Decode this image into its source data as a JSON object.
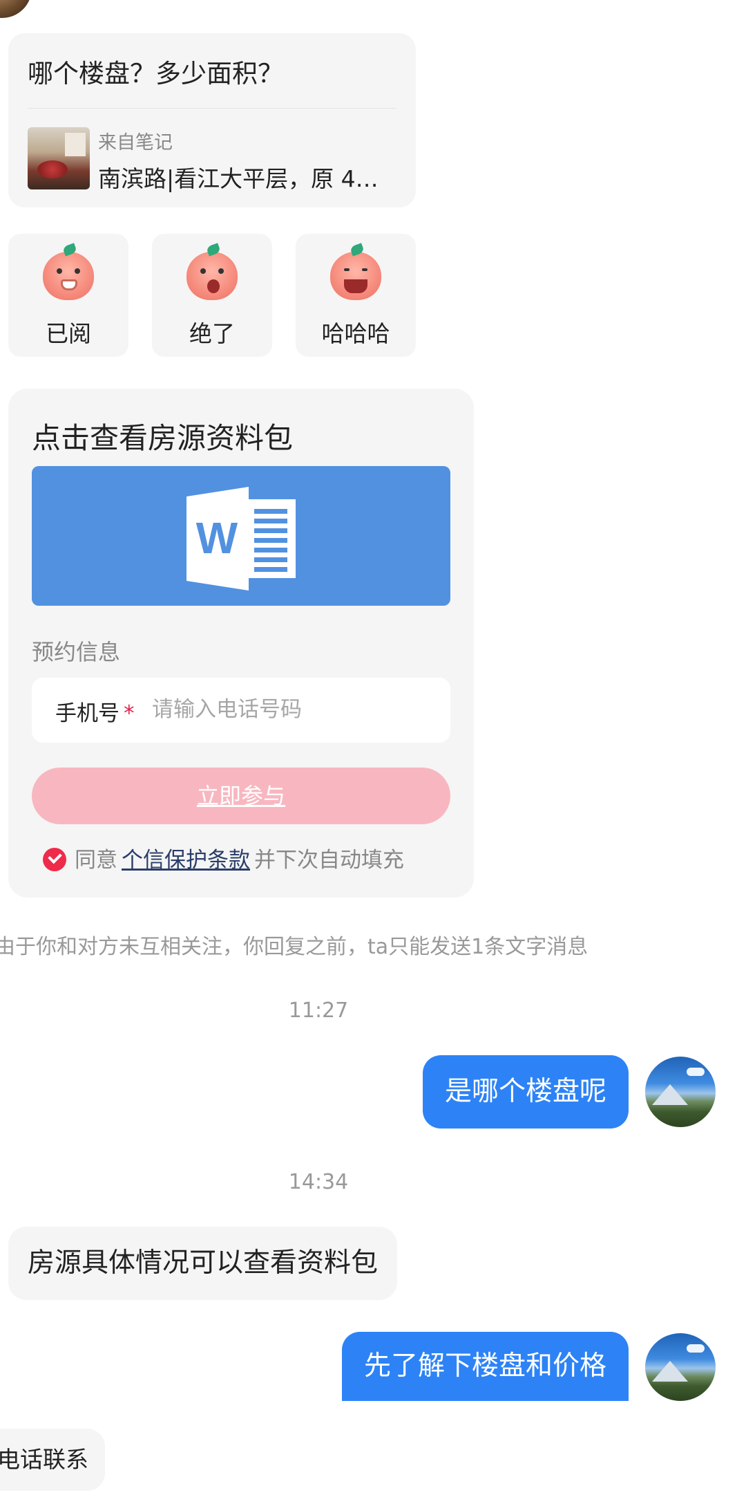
{
  "quote_card": {
    "cut_text": "……………………",
    "question": "哪个楼盘？多少面积？",
    "source_label": "来自笔记",
    "note_title": "南滨路|看江大平层，原 4…"
  },
  "stickers": [
    {
      "label": "已阅",
      "icon": "drinking-peach-sticker-icon"
    },
    {
      "label": "绝了",
      "icon": "thumbs-up-peach-sticker-icon"
    },
    {
      "label": "哈哈哈",
      "icon": "laughing-peach-sticker-icon"
    }
  ],
  "doc_card": {
    "title": "点击查看房源资料包",
    "banner_icon": "word-document-icon",
    "banner_color": "#5291e0",
    "appointment_label": "预约信息",
    "phone_label": "手机号",
    "required_mark": "*",
    "phone_placeholder": "请输入电话号码",
    "phone_value": "",
    "join_button": "立即参与",
    "agree_prefix": "同意",
    "agree_link": "个信保护条款",
    "agree_suffix": "并下次自动填充"
  },
  "system_tip": "由于你和对方未互相关注，你回复之前，ta只能发送1条文字消息",
  "messages": [
    {
      "time": "11:27"
    },
    {
      "direction": "out",
      "text": "是哪个楼盘呢"
    },
    {
      "time": "14:34"
    },
    {
      "direction": "in",
      "text": "房源具体情况可以查看资料包"
    },
    {
      "direction": "out",
      "text": "先了解下楼盘和价格"
    },
    {
      "direction": "in",
      "text": "电话联系"
    }
  ],
  "colors": {
    "accent_blue": "#2d83f6",
    "button_pink": "#f8b7c0",
    "check_red": "#ef2b4a"
  }
}
